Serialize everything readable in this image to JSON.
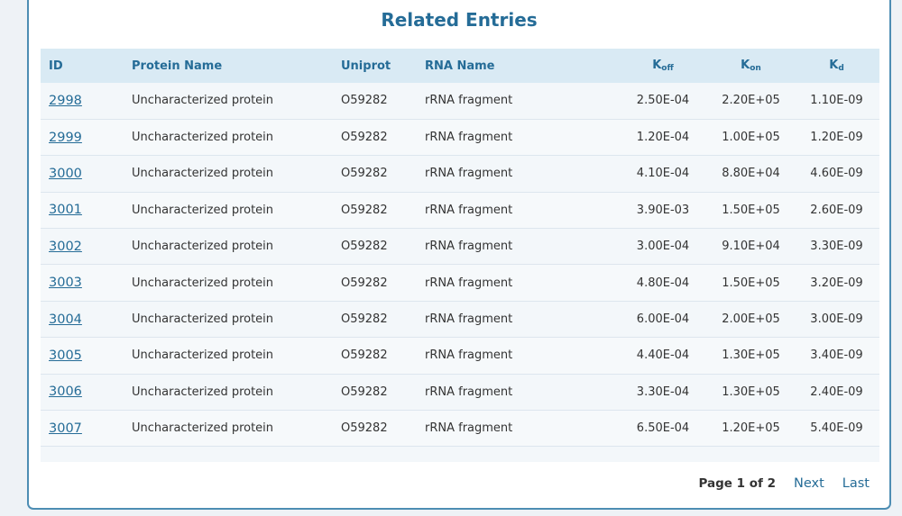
{
  "title": "Related Entries",
  "table": {
    "columns": [
      {
        "label": "ID",
        "sub": ""
      },
      {
        "label": "Protein Name",
        "sub": ""
      },
      {
        "label": "Uniprot",
        "sub": ""
      },
      {
        "label": "RNA Name",
        "sub": ""
      },
      {
        "label": "K",
        "sub": "off"
      },
      {
        "label": "K",
        "sub": "on"
      },
      {
        "label": "K",
        "sub": "d"
      }
    ],
    "rows": [
      {
        "id": "2998",
        "protein": "Uncharacterized protein",
        "uniprot": "O59282",
        "rna": "rRNA fragment",
        "koff": "2.50E-04",
        "kon": "2.20E+05",
        "kd": "1.10E-09"
      },
      {
        "id": "2999",
        "protein": "Uncharacterized protein",
        "uniprot": "O59282",
        "rna": "rRNA fragment",
        "koff": "1.20E-04",
        "kon": "1.00E+05",
        "kd": "1.20E-09"
      },
      {
        "id": "3000",
        "protein": "Uncharacterized protein",
        "uniprot": "O59282",
        "rna": "rRNA fragment",
        "koff": "4.10E-04",
        "kon": "8.80E+04",
        "kd": "4.60E-09"
      },
      {
        "id": "3001",
        "protein": "Uncharacterized protein",
        "uniprot": "O59282",
        "rna": "rRNA fragment",
        "koff": "3.90E-03",
        "kon": "1.50E+05",
        "kd": "2.60E-09"
      },
      {
        "id": "3002",
        "protein": "Uncharacterized protein",
        "uniprot": "O59282",
        "rna": "rRNA fragment",
        "koff": "3.00E-04",
        "kon": "9.10E+04",
        "kd": "3.30E-09"
      },
      {
        "id": "3003",
        "protein": "Uncharacterized protein",
        "uniprot": "O59282",
        "rna": "rRNA fragment",
        "koff": "4.80E-04",
        "kon": "1.50E+05",
        "kd": "3.20E-09"
      },
      {
        "id": "3004",
        "protein": "Uncharacterized protein",
        "uniprot": "O59282",
        "rna": "rRNA fragment",
        "koff": "6.00E-04",
        "kon": "2.00E+05",
        "kd": "3.00E-09"
      },
      {
        "id": "3005",
        "protein": "Uncharacterized protein",
        "uniprot": "O59282",
        "rna": "rRNA fragment",
        "koff": "4.40E-04",
        "kon": "1.30E+05",
        "kd": "3.40E-09"
      },
      {
        "id": "3006",
        "protein": "Uncharacterized protein",
        "uniprot": "O59282",
        "rna": "rRNA fragment",
        "koff": "3.30E-04",
        "kon": "1.30E+05",
        "kd": "2.40E-09"
      },
      {
        "id": "3007",
        "protein": "Uncharacterized protein",
        "uniprot": "O59282",
        "rna": "rRNA fragment",
        "koff": "6.50E-04",
        "kon": "1.20E+05",
        "kd": "5.40E-09"
      }
    ]
  },
  "pager": {
    "page_info": "Page 1 of 2",
    "next": "Next",
    "last": "Last"
  }
}
